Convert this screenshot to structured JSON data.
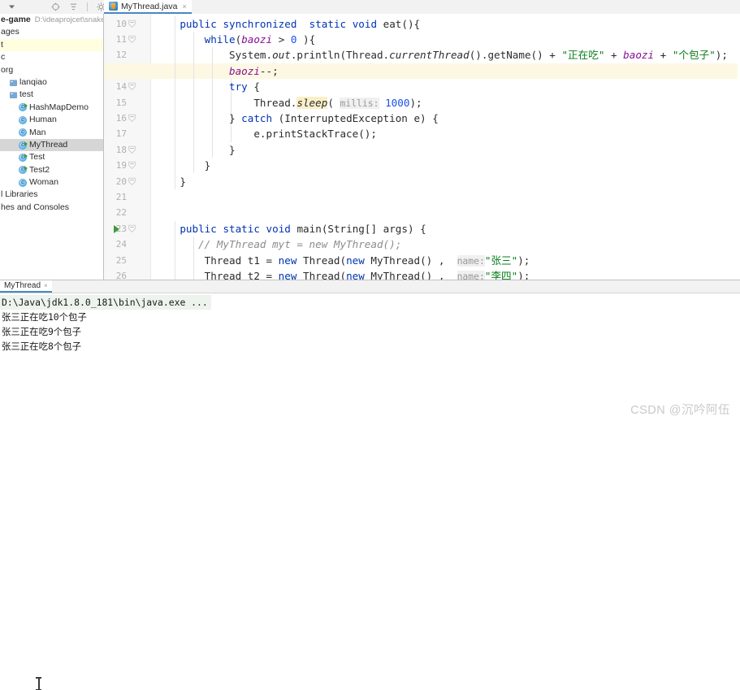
{
  "window": {
    "toolbar_icons": [
      "collapse-all-icon",
      "locate-icon",
      "settings-gear-icon",
      "minimize-icon"
    ],
    "sidebar_dropdown": "▾"
  },
  "editor_tab": {
    "label": "MyThread.java",
    "close": "×",
    "icon": "java-class-file-icon"
  },
  "sidebar": {
    "rows": [
      {
        "indent": 0,
        "icon": "none",
        "text": "e-game",
        "suffix": "D:\\ideaprojcet\\snake-game",
        "style": "bold"
      },
      {
        "indent": 0,
        "icon": "none",
        "text": "ages",
        "suffix": "",
        "style": "normal"
      },
      {
        "indent": 0,
        "icon": "none",
        "text": "t",
        "suffix": "",
        "style": "highlight"
      },
      {
        "indent": 0,
        "icon": "none",
        "text": "c",
        "suffix": "",
        "style": "normal"
      },
      {
        "indent": 0,
        "icon": "none",
        "text": "org",
        "suffix": "",
        "style": "normal"
      },
      {
        "indent": 1,
        "icon": "folder",
        "text": "lanqiao",
        "suffix": "",
        "style": "normal"
      },
      {
        "indent": 1,
        "icon": "folder",
        "text": "test",
        "suffix": "",
        "style": "normal"
      },
      {
        "indent": 2,
        "icon": "class-runnable",
        "text": "HashMapDemo",
        "suffix": "",
        "style": "normal"
      },
      {
        "indent": 2,
        "icon": "class",
        "text": "Human",
        "suffix": "",
        "style": "normal"
      },
      {
        "indent": 2,
        "icon": "class",
        "text": "Man",
        "suffix": "",
        "style": "normal"
      },
      {
        "indent": 2,
        "icon": "class-runnable",
        "text": "MyThread",
        "suffix": "",
        "style": "selected"
      },
      {
        "indent": 2,
        "icon": "class-runnable",
        "text": "Test",
        "suffix": "",
        "style": "normal"
      },
      {
        "indent": 2,
        "icon": "class-runnable",
        "text": "Test2",
        "suffix": "",
        "style": "normal"
      },
      {
        "indent": 2,
        "icon": "class",
        "text": "Woman",
        "suffix": "",
        "style": "normal"
      },
      {
        "indent": 0,
        "icon": "none",
        "text": "l Libraries",
        "suffix": "",
        "style": "normal"
      },
      {
        "indent": 0,
        "icon": "none",
        "text": "hes and Consoles",
        "suffix": "",
        "style": "normal"
      }
    ]
  },
  "code": {
    "first_line": 10,
    "highlighted_line": 13,
    "run_marker_line": 23,
    "fold_lines": [
      10,
      11,
      14,
      16,
      18,
      19,
      20,
      23
    ],
    "lines": [
      {
        "n": 10,
        "text": "    public synchronized  static void eat(){"
      },
      {
        "n": 11,
        "text": "        while(baozi > 0 ){"
      },
      {
        "n": 12,
        "text": "            System.out.println(Thread.currentThread().getName() + \"正在吃\" + baozi + \"个包子\");"
      },
      {
        "n": 13,
        "text": "            baozi--;"
      },
      {
        "n": 14,
        "text": "            try {"
      },
      {
        "n": 15,
        "text": "                Thread.sleep( millis: 1000);"
      },
      {
        "n": 16,
        "text": "            } catch (InterruptedException e) {"
      },
      {
        "n": 17,
        "text": "                e.printStackTrace();"
      },
      {
        "n": 18,
        "text": "            }"
      },
      {
        "n": 19,
        "text": "        }"
      },
      {
        "n": 20,
        "text": "    }"
      },
      {
        "n": 21,
        "text": ""
      },
      {
        "n": 22,
        "text": ""
      },
      {
        "n": 23,
        "text": "    public static void main(String[] args) {"
      },
      {
        "n": 24,
        "text": "       // MyThread myt = new MyThread();"
      },
      {
        "n": 25,
        "text": "        Thread t1 = new Thread(new MyThread() ,  name: \"张三\");"
      },
      {
        "n": 26,
        "text": "        Thread t2 = new Thread(new MyThread() ,  name: \"李四\");"
      }
    ],
    "tokens": {
      "kw_public": "public",
      "kw_synchronized": "synchronized",
      "kw_static": "static",
      "kw_void": "void",
      "kw_while": "while",
      "kw_try": "try",
      "kw_catch": "catch",
      "kw_new": "new",
      "method_eat": "eat",
      "method_main": "main",
      "field_baozi": "baozi",
      "str_eating": "\"正在吃\"",
      "str_buns": "\"个包子\"",
      "str_zhangsan": "\"张三\"",
      "str_lisi": "\"李四\"",
      "num_zero": "0",
      "num_1000": "1000",
      "hint_millis": "millis:",
      "hint_name": "name:",
      "comment_24": "// MyThread myt = new MyThread();"
    }
  },
  "console": {
    "tab_label": "MyThread",
    "tab_close": "×",
    "lines": [
      "D:\\Java\\jdk1.8.0_181\\bin\\java.exe ...",
      "张三正在吃10个包子",
      "张三正在吃9个包子",
      "张三正在吃8个包子"
    ]
  },
  "watermark": "CSDN @沉吟阿伍",
  "colors": {
    "keyword": "#0033b3",
    "string": "#067d17",
    "number": "#1750eb",
    "field": "#871094",
    "comment": "#8c8c8c",
    "tab_underline": "#4a86c8",
    "selection": "#d6d6d6",
    "caret_line": "#fdf8e3"
  }
}
